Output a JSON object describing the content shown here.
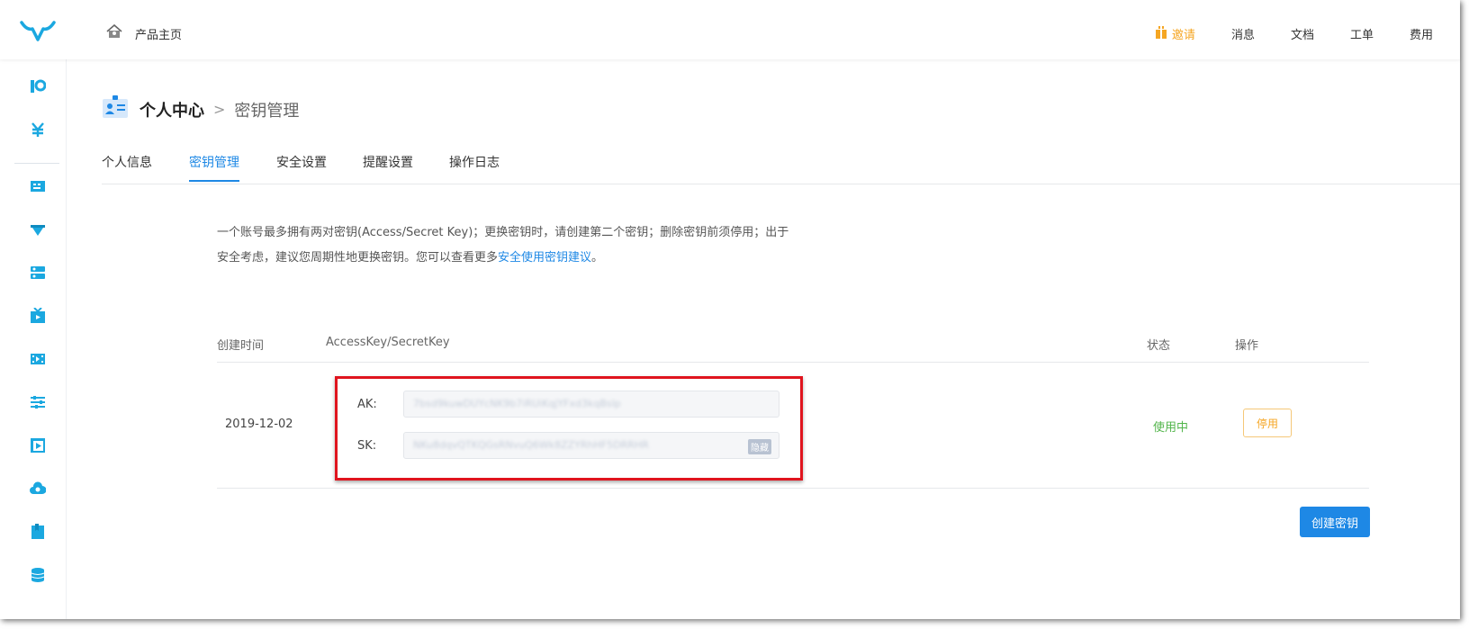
{
  "header": {
    "home_label": "产品主页",
    "nav": [
      {
        "label": "邀请",
        "icon": "gift-icon",
        "color": "#f5a623"
      },
      {
        "label": "消息"
      },
      {
        "label": "文档"
      },
      {
        "label": "工单"
      },
      {
        "label": "费用"
      }
    ]
  },
  "sidebar": {
    "icons": [
      "analytics-icon",
      "yen-icon",
      "dashboard-icon",
      "cdn-icon",
      "storage-icon",
      "live-icon",
      "video-icon",
      "settings-sliders-icon",
      "media-icon",
      "cloud-icon",
      "bookmark-icon",
      "database-icon"
    ]
  },
  "breadcrumb": {
    "current": "个人中心",
    "separator": ">",
    "sub": "密钥管理"
  },
  "tabs": [
    "个人信息",
    "密钥管理",
    "安全设置",
    "提醒设置",
    "操作日志"
  ],
  "active_tab": 1,
  "notice": {
    "text": "一个账号最多拥有两对密钥(Access/Secret Key)；更换密钥时，请创建第二个密钥；删除密钥前须停用；出于安全考虑，建议您周期性地更换密钥。您可以查看更多",
    "link": "安全使用密钥建议",
    "suffix": "。"
  },
  "table": {
    "columns": [
      "创建时间",
      "AccessKey/SecretKey",
      "状态",
      "操作"
    ],
    "rows": [
      {
        "date": "2019-12-02",
        "ak_label": "AK:",
        "ak_value": "7bsd9kuwDUYcNK9b7iRUiKqjYFxd3kqBslp",
        "sk_label": "SK:",
        "sk_value": "NKu8dqvQTKQGsRNvuQ6Wk8ZZYRhHF5DRRHR",
        "hide_label": "隐藏",
        "status": "使用中",
        "action": "停用"
      }
    ]
  },
  "create_button": "创建密钥",
  "colors": {
    "accent": "#1e88e5",
    "status_active": "#52b54b",
    "warning": "#f5a623",
    "highlight_box": "#e0141e"
  }
}
